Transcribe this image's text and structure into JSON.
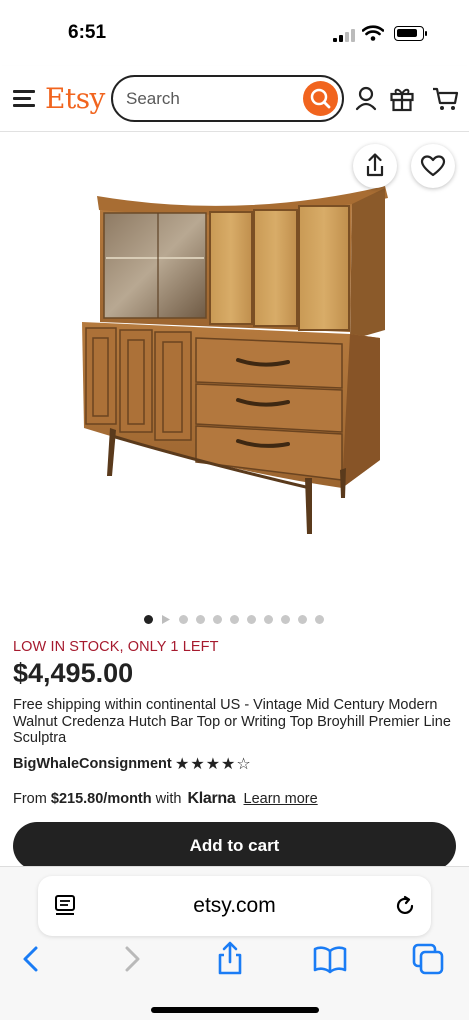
{
  "status_bar": {
    "time": "6:51"
  },
  "header": {
    "logo": "Etsy",
    "search_placeholder": "Search",
    "brand_color": "#f1641e",
    "icons": [
      "menu-icon",
      "search-icon",
      "account-icon",
      "gift-icon",
      "cart-icon"
    ]
  },
  "hero": {
    "image_alt": "Vintage walnut credenza hutch",
    "image_count": 11,
    "active_index": 0
  },
  "product": {
    "stock_notice": "LOW IN STOCK, ONLY 1 LEFT",
    "price": "$4,495.00",
    "title": "Free shipping within continental US - Vintage Mid Century Modern Walnut Credenza Hutch Bar Top or Writing Top Broyhill Premier Line Sculptra",
    "shop_name": "BigWhaleConsignment",
    "rating": 4,
    "rating_max": 5,
    "stars_text": "★★★★☆",
    "financing": {
      "prefix": "From",
      "amount": "$215.80/month",
      "with": "with",
      "provider": "Klarna",
      "link": "Learn more"
    },
    "add_to_cart_label": "Add to cart"
  },
  "browser": {
    "url": "etsy.com"
  }
}
